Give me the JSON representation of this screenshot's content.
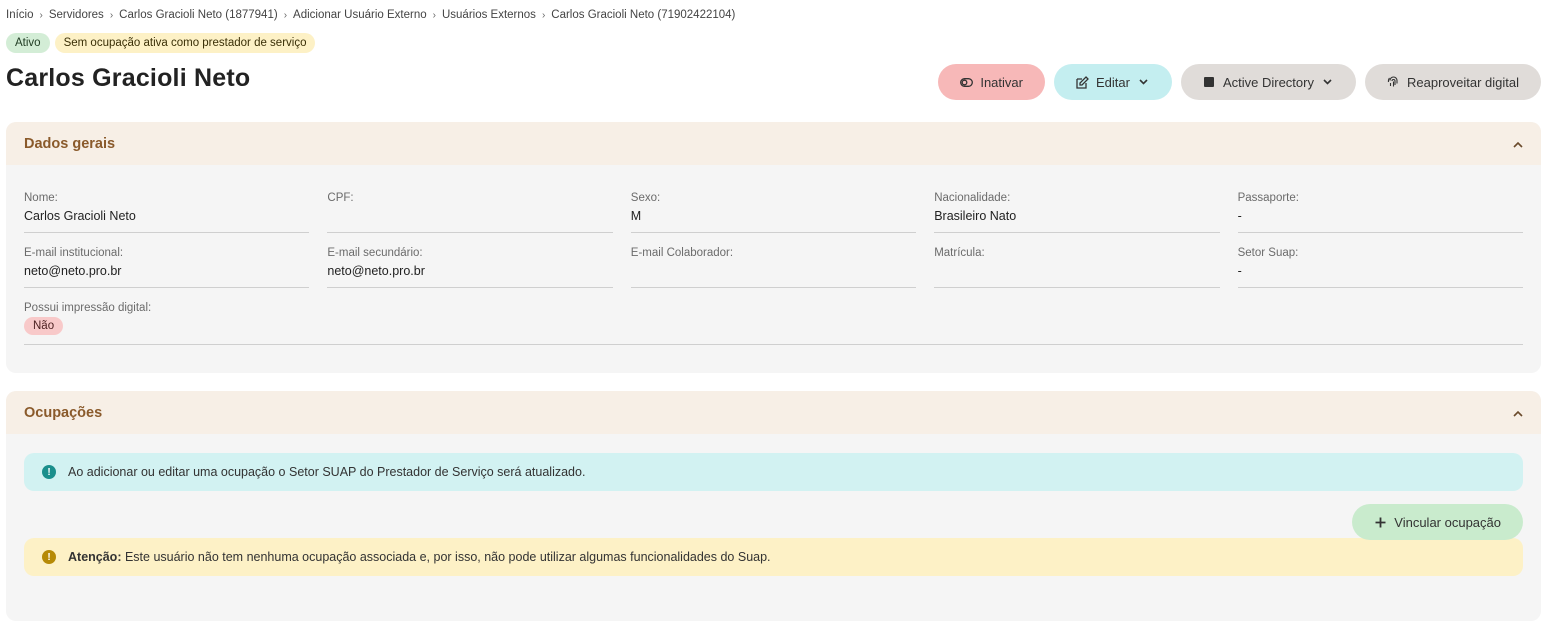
{
  "breadcrumb": [
    "Início",
    "Servidores",
    "Carlos Gracioli Neto (1877941)",
    "Adicionar Usuário Externo",
    "Usuários Externos",
    "Carlos Gracioli Neto (71902422104)"
  ],
  "badges": {
    "status": "Ativo",
    "occupation": "Sem ocupação ativa como prestador de serviço"
  },
  "title": "Carlos Gracioli Neto",
  "actions": {
    "inativar": "Inativar",
    "editar": "Editar",
    "active_directory": "Active Directory",
    "reaproveitar": "Reaproveitar digital"
  },
  "dados_gerais": {
    "heading": "Dados gerais",
    "fields": [
      {
        "label": "Nome:",
        "value": "Carlos Gracioli Neto"
      },
      {
        "label": "CPF:",
        "value": ""
      },
      {
        "label": "Sexo:",
        "value": "M"
      },
      {
        "label": "Nacionalidade:",
        "value": "Brasileiro Nato"
      },
      {
        "label": "Passaporte:",
        "value": "-"
      },
      {
        "label": "E-mail institucional:",
        "value": "neto@neto.pro.br"
      },
      {
        "label": "E-mail secundário:",
        "value": "neto@neto.pro.br"
      },
      {
        "label": "E-mail Colaborador:",
        "value": ""
      },
      {
        "label": "Matrícula:",
        "value": ""
      },
      {
        "label": "Setor Suap:",
        "value": "-"
      }
    ],
    "digital": {
      "label": "Possui impressão digital:",
      "value": "Não"
    }
  },
  "ocupacoes": {
    "heading": "Ocupações",
    "info_text": "Ao adicionar ou editar uma ocupação o Setor SUAP do Prestador de Serviço será atualizado.",
    "vincular": "Vincular ocupação",
    "warn_strong": "Atenção:",
    "warn_text": "Este usuário não tem nenhuma ocupação associada e, por isso, não pode utilizar algumas funcionalidades do Suap."
  },
  "colors": {
    "accent_brown": "#8a5a2b",
    "danger_pill": "#f7b8b8",
    "info_bg": "#d2f2f2",
    "warn_bg": "#fdf1c6"
  }
}
